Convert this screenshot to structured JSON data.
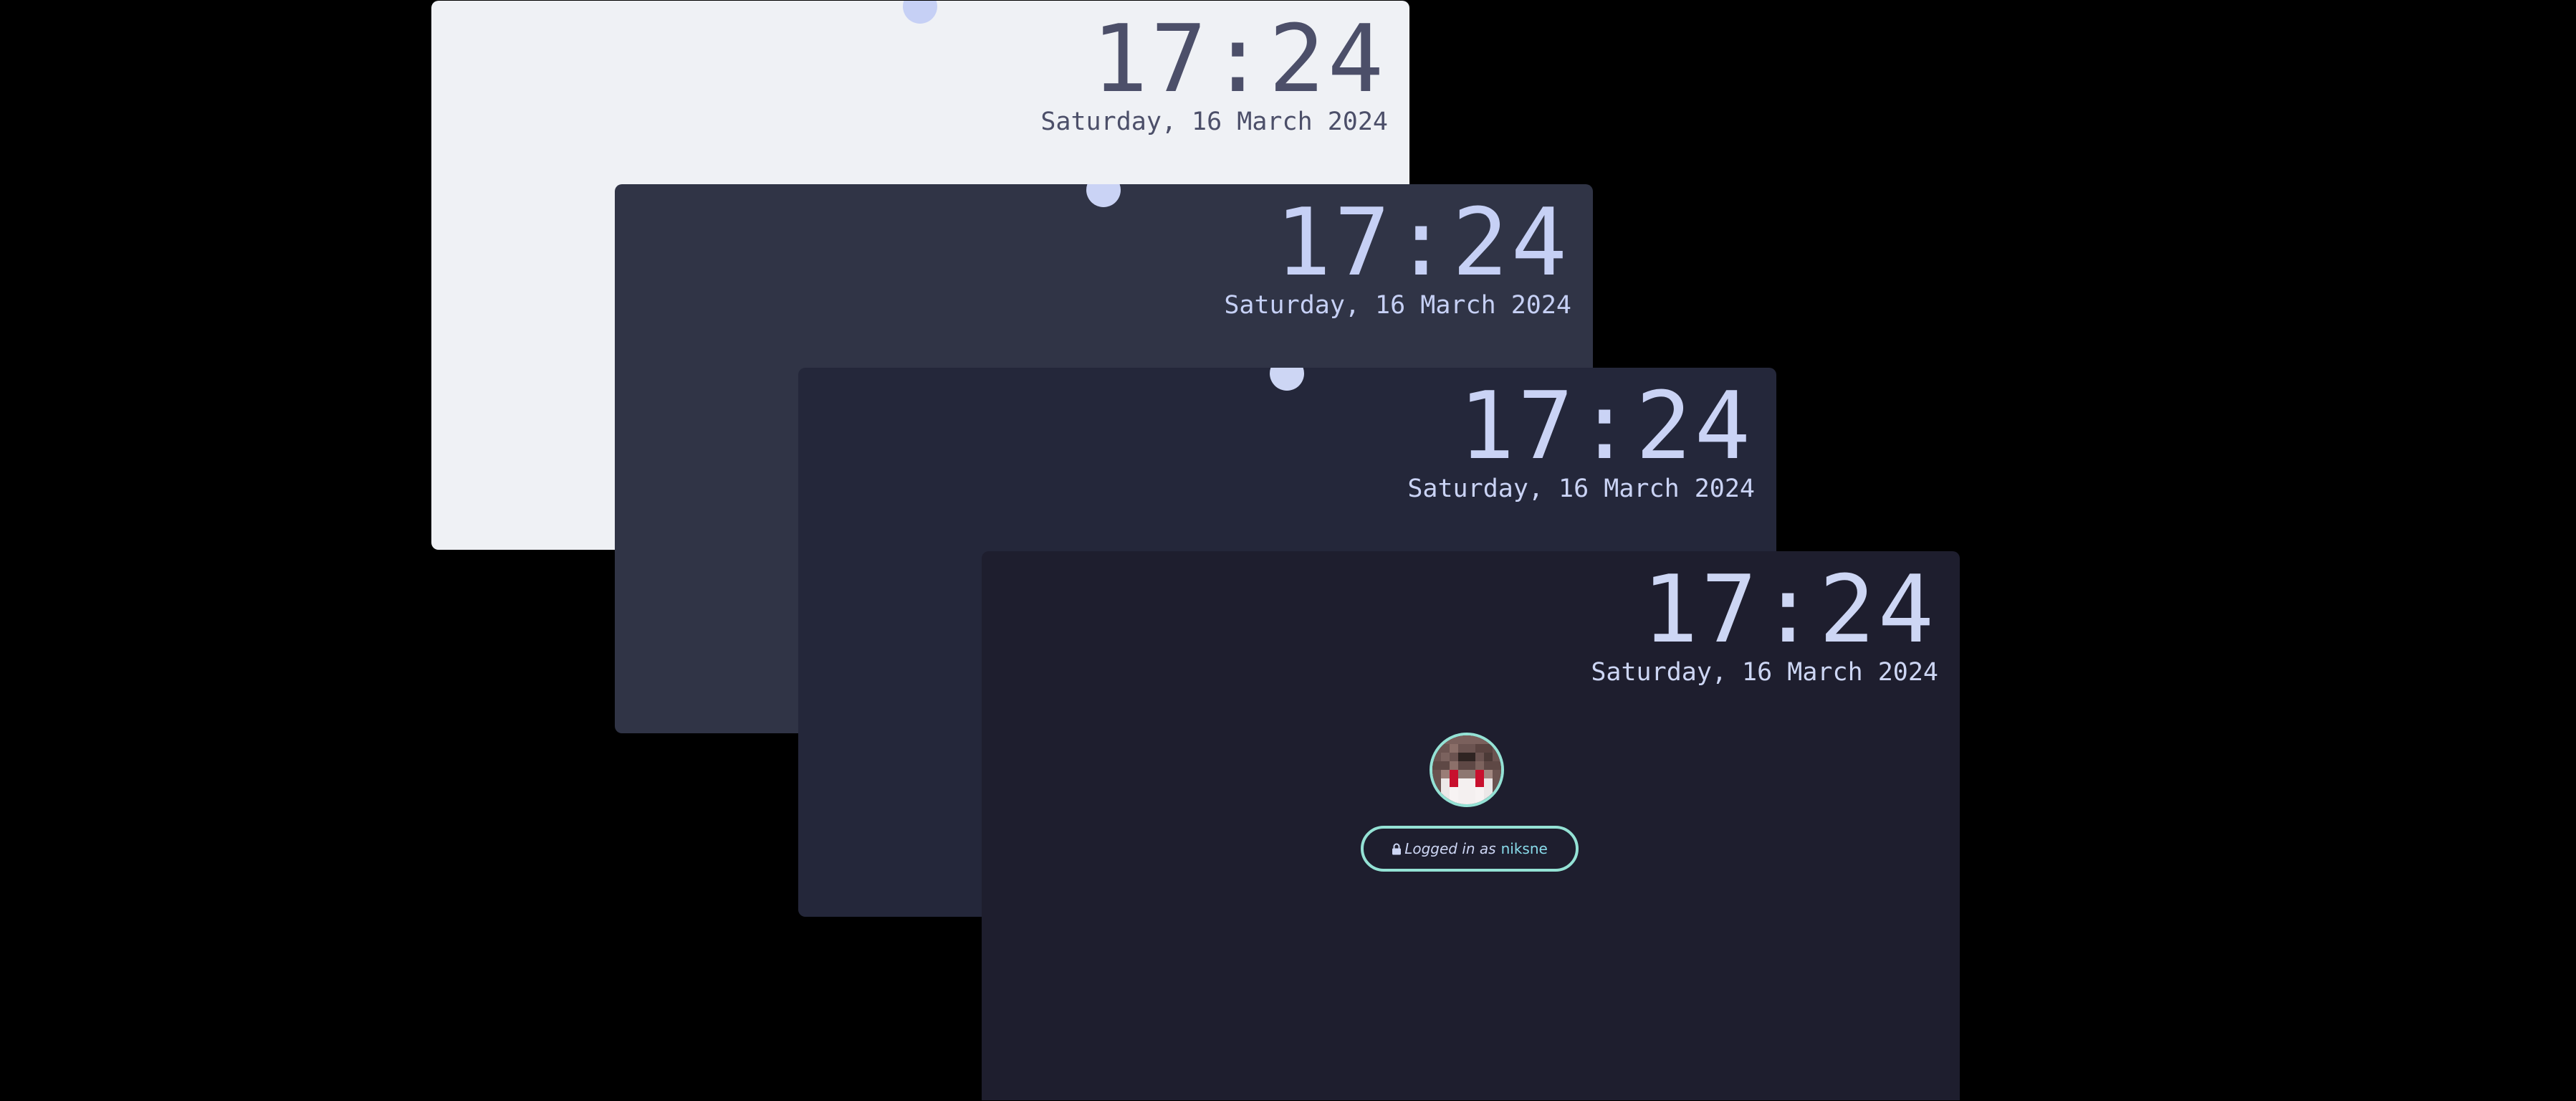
{
  "screens": [
    {
      "id": "latte",
      "time": "17:24",
      "date": "Saturday, 16 March 2024",
      "bg": "#eff1f5",
      "fg": "#4c4f69"
    },
    {
      "id": "frappe",
      "time": "17:24",
      "date": "Saturday, 16 March 2024",
      "bg": "#303446",
      "fg": "#c6d0f5"
    },
    {
      "id": "macchiato",
      "time": "17:24",
      "date": "Saturday, 16 March 2024",
      "bg": "#24273a",
      "fg": "#cad3f5"
    },
    {
      "id": "mocha",
      "time": "17:24",
      "date": "Saturday, 16 March 2024",
      "bg": "#1e1e2e",
      "fg": "#cdd6f4"
    }
  ],
  "login": {
    "prefix": "Logged in as",
    "username": "niksne",
    "lock_icon": "lock-icon",
    "accent": "#94e2d5",
    "username_color": "#89dceb",
    "text_color": "#cdd6f4"
  },
  "avatar": {
    "icon": "pixel-avatar"
  }
}
